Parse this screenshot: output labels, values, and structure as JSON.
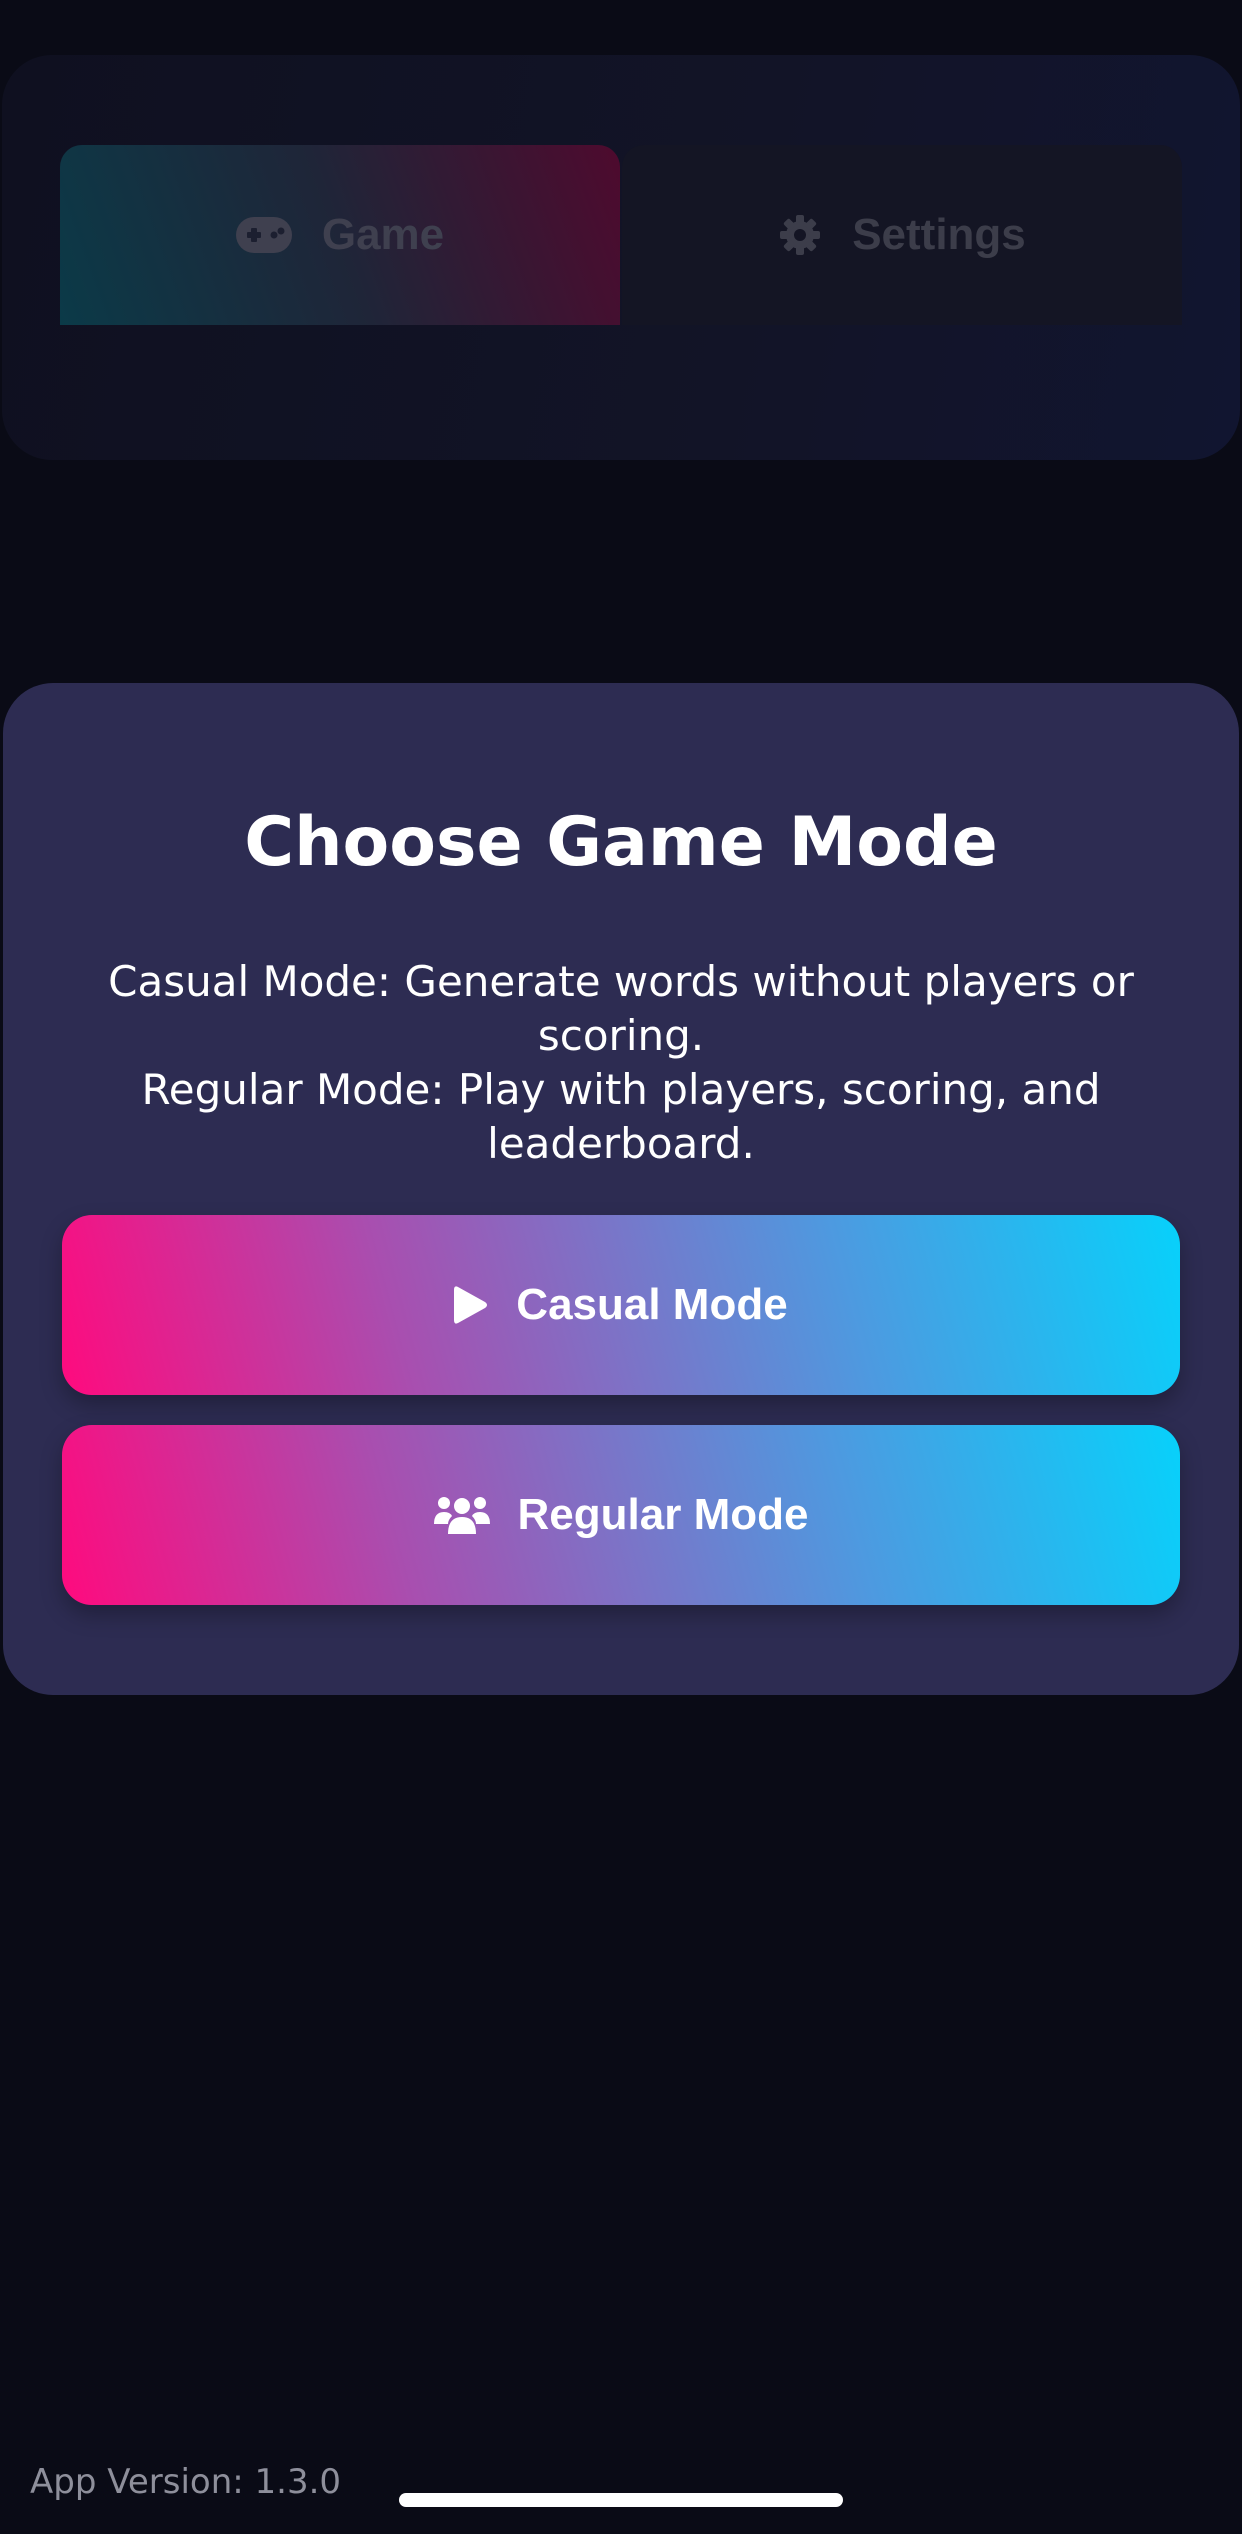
{
  "tabs": [
    {
      "label": "Game",
      "icon": "gamepad-icon",
      "active": true
    },
    {
      "label": "Settings",
      "icon": "gear-icon",
      "active": false
    }
  ],
  "modal": {
    "title": "Choose Game Mode",
    "description_lines": [
      "Casual Mode: Generate words without players or scoring.",
      "Regular Mode: Play with players, scoring, and leaderboard."
    ],
    "buttons": [
      {
        "label": "Casual Mode",
        "icon": "play-icon"
      },
      {
        "label": "Regular Mode",
        "icon": "users-icon"
      }
    ]
  },
  "footer": {
    "app_version": "App Version: 1.3.0"
  },
  "colors": {
    "background": "#0a0b16",
    "modal_background": "#2d2c52",
    "button_gradient_start": "#ff0a7e",
    "button_gradient_end": "#07d1fb",
    "dimmed_text": "#3c3d4a"
  }
}
